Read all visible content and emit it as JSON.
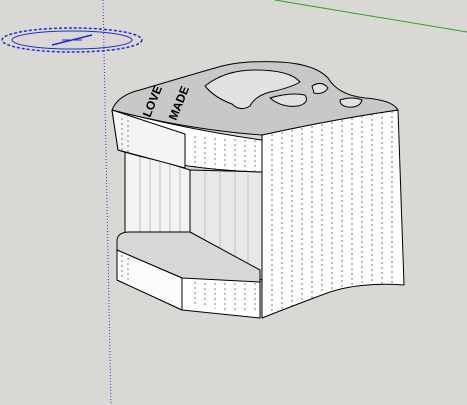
{
  "scene": {
    "engraved_text": [
      "LOVE",
      "MADE"
    ],
    "colors": {
      "background": "#d9d8d4",
      "face_light": "#ffffff",
      "face_shadow": "#e6e6e6",
      "top_face": "#c9c9c9",
      "edge": "#000000",
      "axis_green": "#2aa02a",
      "axis_blue": "#2f3fd0",
      "compass": "#1f2fd0"
    },
    "icons": [
      "north-compass-icon",
      "green-axis-line",
      "blue-axis-line"
    ]
  }
}
